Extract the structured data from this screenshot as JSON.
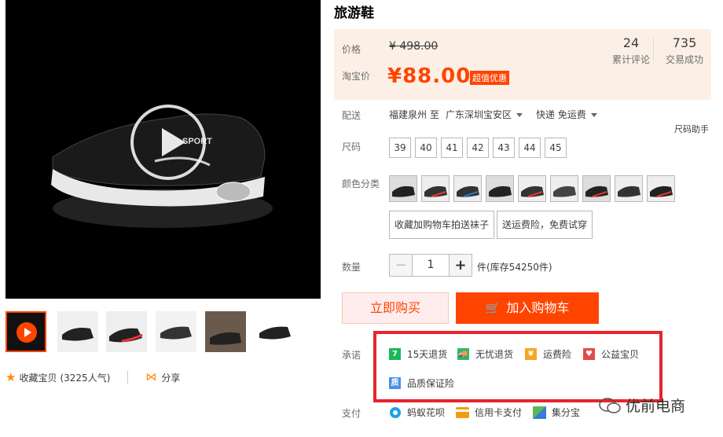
{
  "product": {
    "title": "旅游鞋"
  },
  "price": {
    "list_label": "价格",
    "list_price": "¥ 498.00",
    "taobao_label": "淘宝价",
    "taobao_price": "¥88.00",
    "promo_tag": "超值优惠"
  },
  "stats": [
    {
      "value": "24",
      "label": "累计评论"
    },
    {
      "value": "735",
      "label": "交易成功"
    }
  ],
  "shipping": {
    "label": "配送",
    "from": "福建泉州 至",
    "to": "广东深圳宝安区",
    "method": "快递 免运费"
  },
  "size": {
    "label": "尺码",
    "help": "尺码助手",
    "options": [
      "39",
      "40",
      "41",
      "42",
      "43",
      "44",
      "45"
    ]
  },
  "colors": {
    "label": "颜色分类",
    "option1": "收藏加购物车拍送袜子",
    "option2": "送运费险，免费试穿"
  },
  "quantity": {
    "label": "数量",
    "minus": "−",
    "value": "1",
    "plus": "+",
    "stock": "件(库存54250件)"
  },
  "actions": {
    "buy_now": "立即购买",
    "add_to_cart": "加入购物车"
  },
  "promise": {
    "label": "承诺",
    "items": [
      {
        "icon": "7",
        "text": "15天退货",
        "color": "#19b955"
      },
      {
        "icon": "🚚",
        "text": "无忧退货",
        "color": "#2eb872"
      },
      {
        "icon": "¥",
        "text": "运费险",
        "color": "#f5a623"
      },
      {
        "icon": "♥",
        "text": "公益宝贝",
        "color": "#e34b4b"
      },
      {
        "icon": "质",
        "text": "品质保证险",
        "color": "#4a90e2"
      }
    ]
  },
  "payment": {
    "label": "支付",
    "methods": [
      {
        "icon": "ant-flower-icon",
        "text": "蚂蚁花呗"
      },
      {
        "icon": "credit-card-icon",
        "text": "信用卡支付"
      },
      {
        "icon": "jifenbao-icon",
        "text": "集分宝"
      }
    ]
  },
  "meta": {
    "favorite": "收藏宝贝",
    "favorite_count": "(3225人气)",
    "share": "分享"
  },
  "watermark": "优前电商",
  "colors_theme": {
    "accent": "#ff4400",
    "price_bg": "#fcf0e6",
    "highlight": "#e8242d"
  }
}
